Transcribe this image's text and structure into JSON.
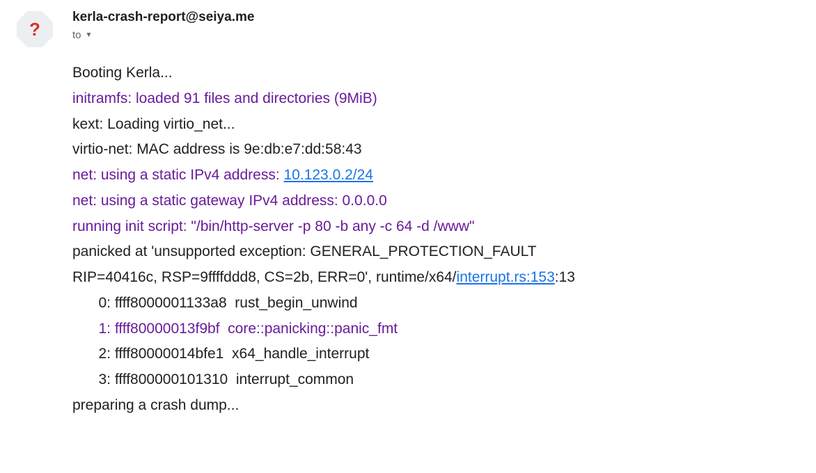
{
  "header": {
    "from": "kerla-crash-report@seiya.me",
    "to_label": "to"
  },
  "body": {
    "l0": "Booting Kerla...",
    "l1": "initramfs: loaded 91 files and directories (9MiB)",
    "l2": "kext: Loading virtio_net...",
    "l3": "virtio-net: MAC address is 9e:db:e7:dd:58:43",
    "l4_pre": "net: using a static IPv4 address: ",
    "l4_link": "10.123.0.2/24",
    "l5": "net: using a static gateway IPv4 address: 0.0.0.0",
    "l6": "running init script: \"/bin/http-server -p 80 -b any -c 64 -d /www\"",
    "l7": "panicked at 'unsupported exception: GENERAL_PROTECTION_FAULT",
    "l8_pre": "RIP=40416c, RSP=9ffffddd8, CS=2b, ERR=0', runtime/x64/",
    "l8_link": "interrupt.rs:153",
    "l8_post": ":13",
    "t0": "   0: ffff8000001133a8  rust_begin_unwind",
    "t1": "   1: ffff80000013f9bf  core::panicking::panic_fmt",
    "t2": "   2: ffff80000014bfe1  x64_handle_interrupt",
    "t3": "   3: ffff800000101310  interrupt_common",
    "l9": "preparing a crash dump..."
  }
}
